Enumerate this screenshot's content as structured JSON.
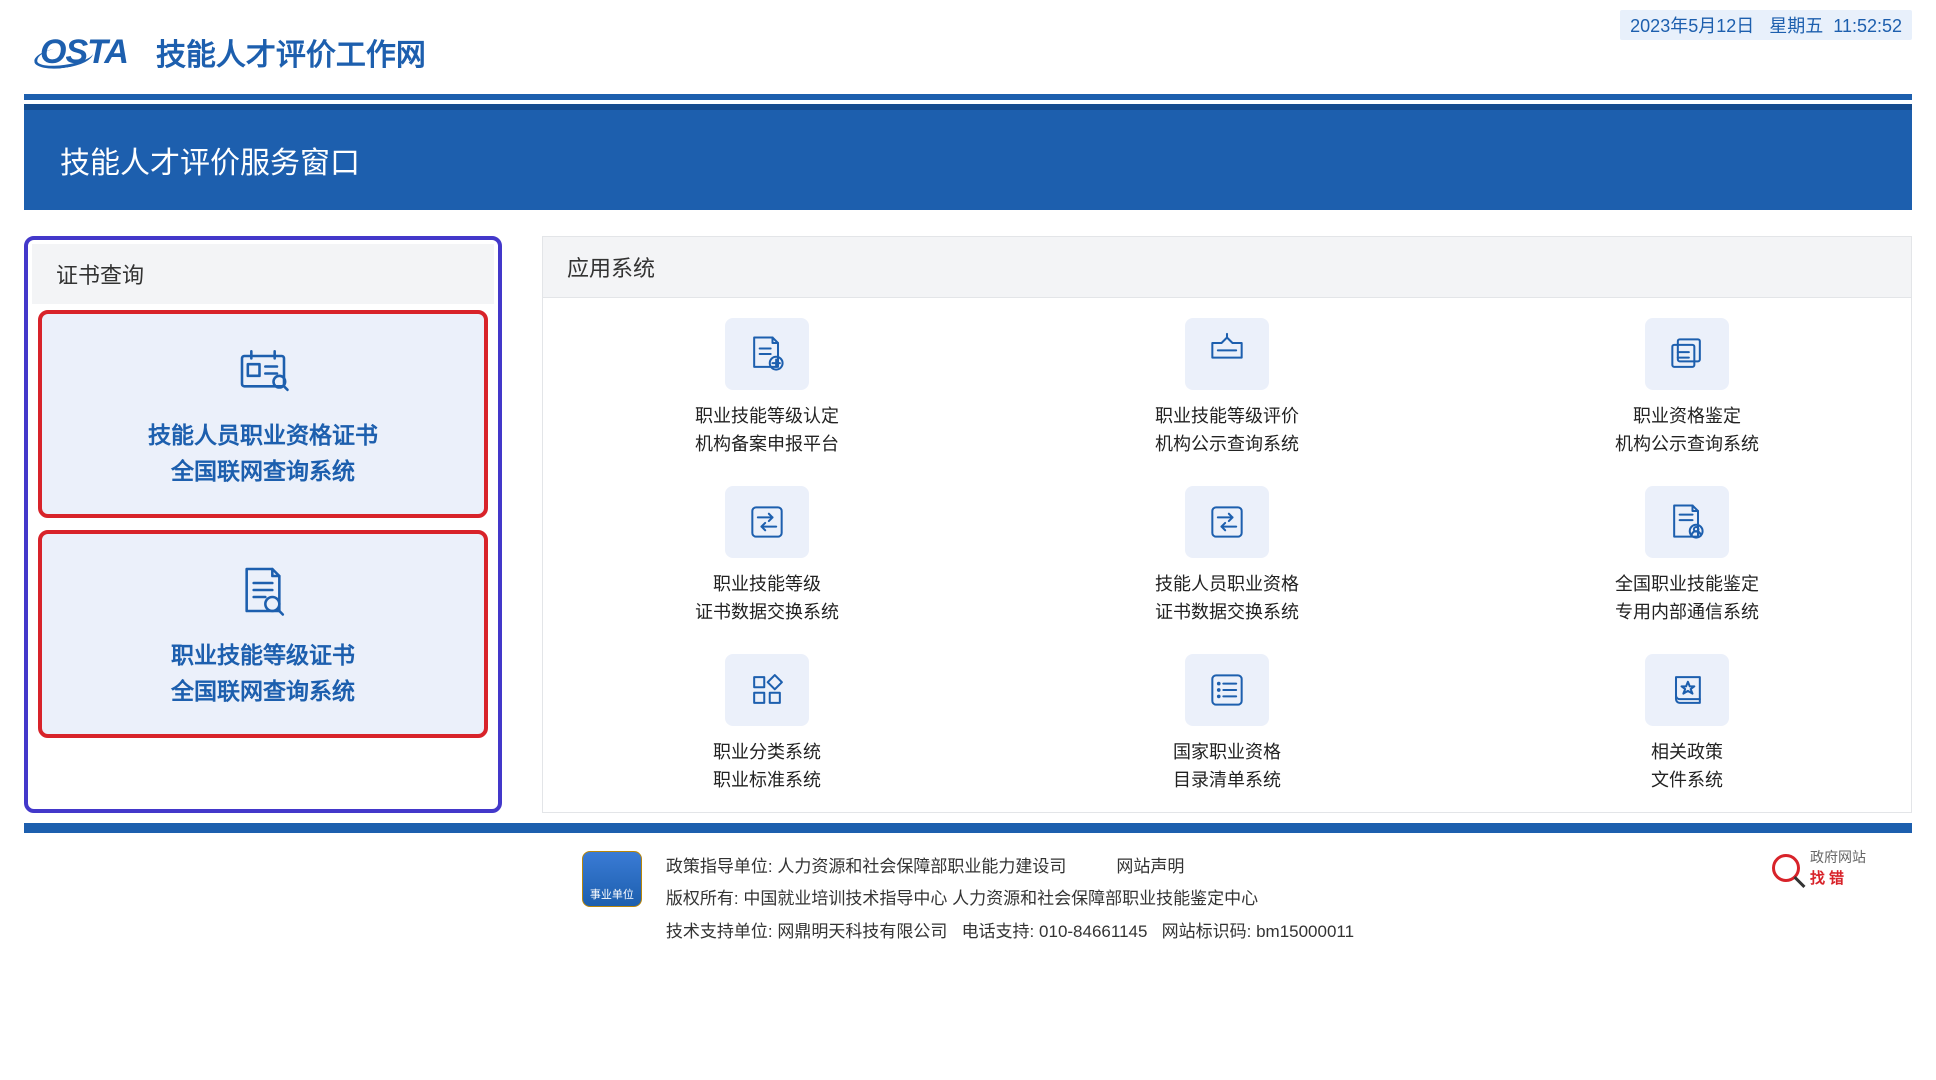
{
  "datetime": {
    "date": "2023年5月12日",
    "weekday": "星期五",
    "time": "11:52:52"
  },
  "header": {
    "logo_text": "OSTA",
    "site_title": "技能人才评价工作网"
  },
  "banner": {
    "title": "技能人才评价服务窗口"
  },
  "left_panel": {
    "title": "证书查询",
    "cards": [
      {
        "icon": "id-card-icon",
        "line1": "技能人员职业资格证书",
        "line2": "全国联网查询系统"
      },
      {
        "icon": "doc-search-icon",
        "line1": "职业技能等级证书",
        "line2": "全国联网查询系统"
      }
    ]
  },
  "right_panel": {
    "title": "应用系统",
    "items": [
      {
        "icon": "doc-up-icon",
        "line1": "职业技能等级认定",
        "line2": "机构备案申报平台"
      },
      {
        "icon": "tag-icon",
        "line1": "职业技能等级评价",
        "line2": "机构公示查询系统"
      },
      {
        "icon": "stack-icon",
        "line1": "职业资格鉴定",
        "line2": "机构公示查询系统"
      },
      {
        "icon": "swap-icon",
        "line1": "职业技能等级",
        "line2": "证书数据交换系统"
      },
      {
        "icon": "swap-icon",
        "line1": "技能人员职业资格",
        "line2": "证书数据交换系统"
      },
      {
        "icon": "doc-user-icon",
        "line1": "全国职业技能鉴定",
        "line2": "专用内部通信系统"
      },
      {
        "icon": "apps-icon",
        "line1": "职业分类系统",
        "line2": "职业标准系统"
      },
      {
        "icon": "list-icon",
        "line1": "国家职业资格",
        "line2": "目录清单系统"
      },
      {
        "icon": "book-star-icon",
        "line1": "相关政策",
        "line2": "文件系统"
      }
    ]
  },
  "footer": {
    "badge": "事业单位",
    "guide_label": "政策指导单位:",
    "guide_value": "人力资源和社会保障部职业能力建设司",
    "statement": "网站声明",
    "copyright_label": "版权所有:",
    "copyright_value": "中国就业培训技术指导中心  人力资源和社会保障部职业技能鉴定中心",
    "tech_label": "技术支持单位:",
    "tech_value": "网鼎明天科技有限公司",
    "tel_label": "电话支持:",
    "tel_value": "010-84661145",
    "site_id_label": "网站标识码:",
    "site_id_value": "bm15000011",
    "gov_label": "政府网站",
    "gov_action": "找错"
  }
}
